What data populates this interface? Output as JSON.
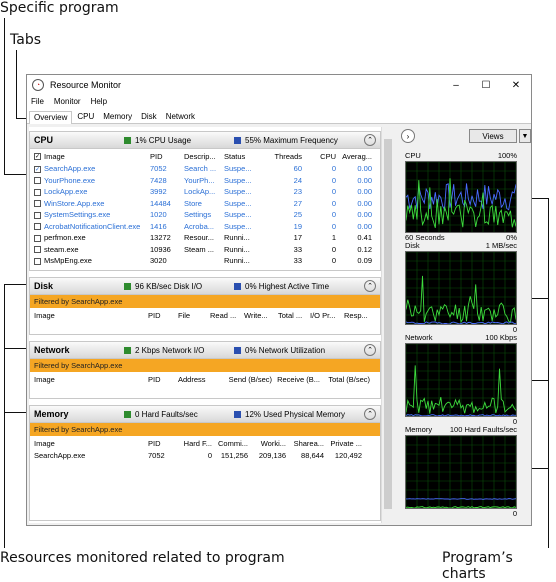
{
  "callouts": {
    "top1": "Specific program",
    "top2": "Tabs",
    "bottom_left": "Resources monitored related to program",
    "bottom_right": "Program’s charts"
  },
  "window": {
    "title": "Resource Monitor",
    "controls": [
      "–",
      "☐",
      "✕"
    ],
    "menu": [
      "File",
      "Monitor",
      "Help"
    ],
    "tabs": [
      "Overview",
      "CPU",
      "Memory",
      "Disk",
      "Network"
    ]
  },
  "cpu": {
    "name": "CPU",
    "stat1": "1% CPU Usage",
    "stat2": "55% Maximum Frequency",
    "columns": [
      "Image",
      "PID",
      "Descrip...",
      "Status",
      "Threads",
      "CPU",
      "Averag..."
    ],
    "rows": [
      {
        "image": "SearchApp.exe",
        "pid": "7052",
        "desc": "Search ...",
        "status": "Suspe...",
        "threads": "60",
        "cpu": "0",
        "avg": "0.00",
        "checked": true,
        "blue": true
      },
      {
        "image": "YourPhone.exe",
        "pid": "7428",
        "desc": "YourPh...",
        "status": "Suspe...",
        "threads": "24",
        "cpu": "0",
        "avg": "0.00",
        "checked": false,
        "blue": true
      },
      {
        "image": "LockApp.exe",
        "pid": "3992",
        "desc": "LockAp...",
        "status": "Suspe...",
        "threads": "23",
        "cpu": "0",
        "avg": "0.00",
        "checked": false,
        "blue": true
      },
      {
        "image": "WinStore.App.exe",
        "pid": "14484",
        "desc": "Store",
        "status": "Suspe...",
        "threads": "27",
        "cpu": "0",
        "avg": "0.00",
        "checked": false,
        "blue": true
      },
      {
        "image": "SystemSettings.exe",
        "pid": "1020",
        "desc": "Settings",
        "status": "Suspe...",
        "threads": "25",
        "cpu": "0",
        "avg": "0.00",
        "checked": false,
        "blue": true
      },
      {
        "image": "AcrobatNotificationClient.exe",
        "pid": "1416",
        "desc": "Acroba...",
        "status": "Suspe...",
        "threads": "19",
        "cpu": "0",
        "avg": "0.00",
        "checked": false,
        "blue": true
      },
      {
        "image": "perfmon.exe",
        "pid": "13272",
        "desc": "Resour...",
        "status": "Runni...",
        "threads": "17",
        "cpu": "1",
        "avg": "0.41",
        "checked": false,
        "blue": false
      },
      {
        "image": "steam.exe",
        "pid": "10936",
        "desc": "Steam ...",
        "status": "Runni...",
        "threads": "33",
        "cpu": "0",
        "avg": "0.12",
        "checked": false,
        "blue": false
      },
      {
        "image": "MsMpEng.exe",
        "pid": "3020",
        "desc": "",
        "status": "Runni...",
        "threads": "33",
        "cpu": "0",
        "avg": "0.09",
        "checked": false,
        "blue": false
      }
    ]
  },
  "disk": {
    "name": "Disk",
    "stat1": "96 KB/sec Disk I/O",
    "stat2": "0% Highest Active Time",
    "filter": "Filtered by SearchApp.exe",
    "columns": [
      "Image",
      "PID",
      "File",
      "Read ...",
      "Write...",
      "Total ...",
      "I/O Pr...",
      "Resp..."
    ]
  },
  "network": {
    "name": "Network",
    "stat1": "2 Kbps Network I/O",
    "stat2": "0% Network Utilization",
    "filter": "Filtered by SearchApp.exe",
    "columns": [
      "Image",
      "PID",
      "Address",
      "Send (B/sec)",
      "Receive (B...",
      "Total (B/sec)"
    ]
  },
  "memory": {
    "name": "Memory",
    "stat1": "0 Hard Faults/sec",
    "stat2": "12% Used Physical Memory",
    "filter": "Filtered by SearchApp.exe",
    "columns": [
      "Image",
      "PID",
      "Hard F...",
      "Commi...",
      "Worki...",
      "Sharea...",
      "Private ..."
    ],
    "rows": [
      {
        "image": "SearchApp.exe",
        "pid": "7052",
        "hard": "0",
        "commit": "151,256",
        "working": "209,136",
        "shareable": "88,644",
        "private": "120,492"
      }
    ]
  },
  "charts": {
    "views_label": "Views",
    "cpu": {
      "label": "CPU",
      "max": "100%",
      "bottom_left": "60 Seconds",
      "bottom_right": "0%"
    },
    "disk": {
      "label": "Disk",
      "max": "1 MB/sec",
      "bottom_right": "0"
    },
    "network": {
      "label": "Network",
      "max": "100 Kbps",
      "bottom_right": "0"
    },
    "memory": {
      "label": "Memory",
      "max": "100 Hard Faults/sec",
      "bottom_right": "0"
    }
  },
  "colors": {
    "cpu_sq": "#2e8b2e",
    "cpu_sq2": "#2a4fb0",
    "filter": "#f5a623",
    "link": "#2a6fd6",
    "graph_green": "#3ddc3d",
    "graph_blue": "#4a6cff"
  }
}
